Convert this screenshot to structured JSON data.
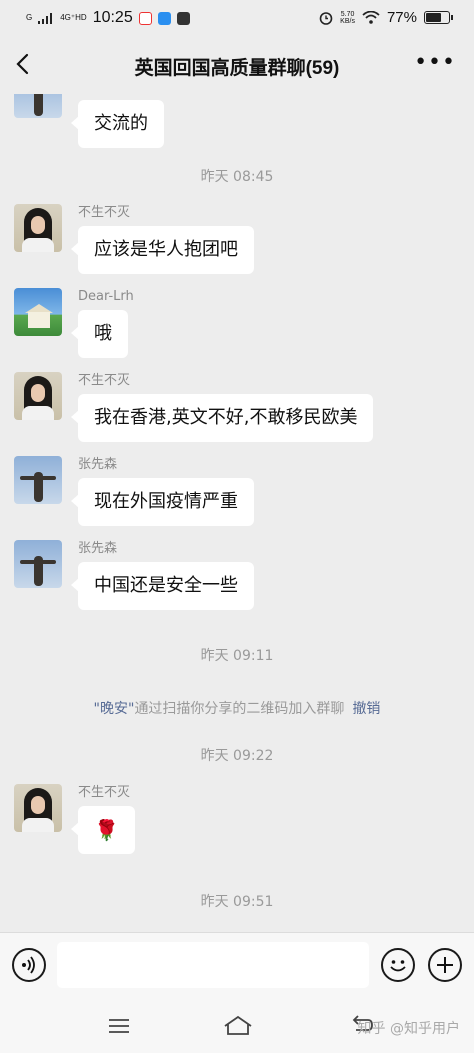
{
  "status_bar": {
    "network": "4G⁺HD",
    "signal_label": "G",
    "time": "10:25",
    "net_speed": "5.70\nKB/s",
    "battery": "77%",
    "battery_level": 0.77
  },
  "header": {
    "title": "英国回国高质量群聊(59)"
  },
  "messages": [
    {
      "sender": "",
      "text": "交流的",
      "avatar": "sky-icon"
    },
    {
      "time": "昨天 08:45"
    },
    {
      "sender": "不生不灭",
      "text": "应该是华人抱团吧",
      "avatar": "woman-icon"
    },
    {
      "sender": "Dear-Lrh",
      "text": "哦",
      "avatar": "beach-icon"
    },
    {
      "sender": "不生不灭",
      "text": "我在香港,英文不好,不敢移民欧美",
      "avatar": "woman-icon"
    },
    {
      "sender": "张先森",
      "text": "现在外国疫情严重",
      "avatar": "sky-icon"
    },
    {
      "sender": "张先森",
      "text": "中国还是安全一些",
      "avatar": "sky-icon"
    },
    {
      "time": "昨天 09:11"
    },
    {
      "system": {
        "name": "\"晚安\"",
        "text": "通过扫描你分享的二维码加入群聊",
        "action": "撤销"
      }
    },
    {
      "time": "昨天 09:22"
    },
    {
      "sender": "不生不灭",
      "text": "🌹",
      "avatar": "woman-icon"
    },
    {
      "time": "昨天 09:51"
    }
  ],
  "watermark": "知乎 @知乎用户",
  "colors": {
    "background": "#ededed",
    "link": "#576b95",
    "bubble": "#ffffff"
  }
}
